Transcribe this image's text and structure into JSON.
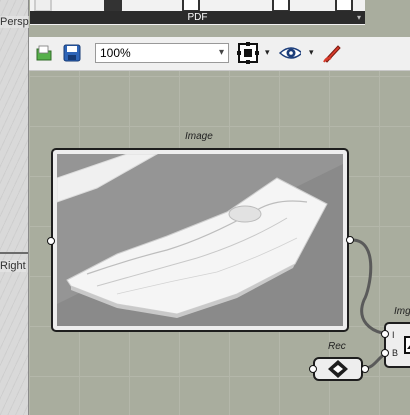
{
  "viewport": {
    "perspective_label": "Persp",
    "right_label": "Right"
  },
  "ribbon": {
    "panel_label": "PDF",
    "expand_glyph": "▾"
  },
  "toolbar": {
    "zoom_value": "100%",
    "zoom_chevron": "▾",
    "icons": [
      "open-file-icon",
      "save-icon",
      "zoom-extents-icon",
      "preview-eye-icon",
      "sketch-pen-icon"
    ]
  },
  "canvas": {
    "image_component": {
      "title": "Image",
      "preview_description_colors": {
        "background": "#8a8a8a",
        "surface": "#f5f5f5"
      }
    },
    "rec_component": {
      "title": "Rec"
    },
    "img_component": {
      "title": "Img",
      "inputs": [
        "I",
        "B"
      ]
    }
  },
  "colors": {
    "canvas_bg": "#a9ad9e",
    "grid_line": "#b4b7aa",
    "component_border": "#1e1e1e",
    "component_fill": "#eeeeee",
    "wire": "#5a5a5a"
  }
}
